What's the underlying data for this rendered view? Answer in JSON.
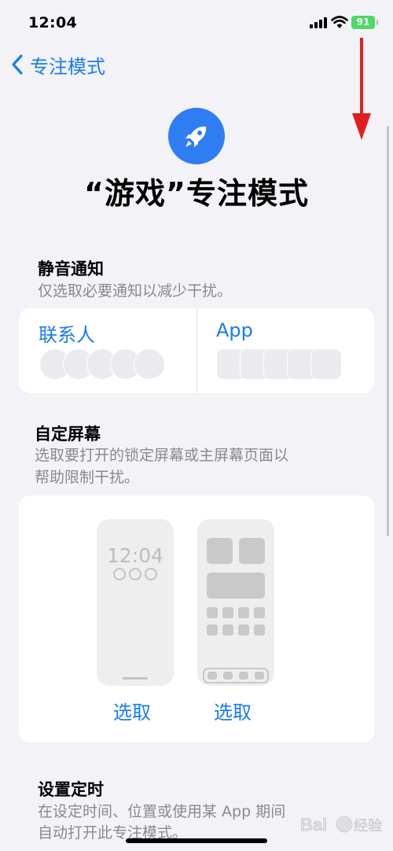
{
  "status_bar": {
    "time": "12:04",
    "battery_level": "91"
  },
  "nav": {
    "back_label": "专注模式"
  },
  "header": {
    "icon": "rocket-icon",
    "icon_color": "#2f7df2",
    "title": "“游戏”专注模式"
  },
  "silence_notifications": {
    "title": "静音通知",
    "subtitle": "仅选取必要通知以减少干扰。",
    "people_label": "联系人",
    "apps_label": "App"
  },
  "customize_screens": {
    "title": "自定屏幕",
    "subtitle_line1": "选取要打开的锁定屏幕或主屏幕页面以",
    "subtitle_line2": "帮助限制干扰。",
    "lock_screen_time": "12:04",
    "lock_choose_label": "选取",
    "home_choose_label": "选取"
  },
  "schedule": {
    "title": "设置定时",
    "subtitle_line1": "在设定时间、位置或使用某 App 期间",
    "subtitle_line2": "自动打开此专注模式。"
  },
  "watermark": {
    "text_brand": "Bai",
    "text_suffix": "经验"
  },
  "colors": {
    "accent": "#1a7cf4",
    "background": "#f2f2f7",
    "annotation_arrow": "#e02020"
  }
}
